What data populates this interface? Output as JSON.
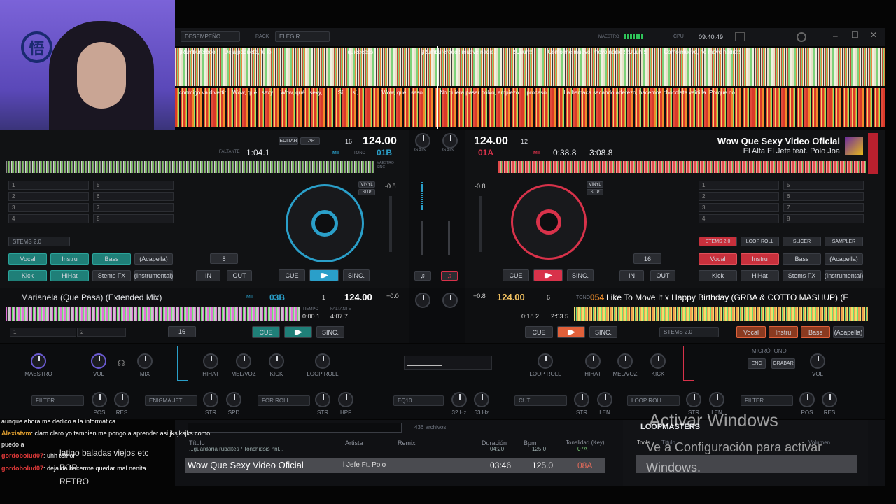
{
  "topbar": {
    "layout": "DESEMPEÑO",
    "rack_label": "RACK",
    "rack_value": "ELEGIR",
    "master_label": "MAESTRO",
    "cpu_label": "CPU",
    "clock": "09:40:49"
  },
  "lyrics": {
    "top": [
      "¡Rumbureroool!",
      "Deja paquete, tú lo",
      "quieeeess",
      "¡Rumbureroool! mueve nadie.",
      "!!Uuuh!!",
      "Como me muevo, movo nadie !!!Uuuh!!!",
      "Como muevo, no move nadie!!!"
    ],
    "bottom": [
      "conmigo va divertir",
      "Wow, qué",
      "sexy.",
      "Wow, qué",
      "sexy,",
      "Sí,",
      "sí,",
      "Wow, qué",
      "seso.",
      "No quiera pasar polvo, empiezo.",
      "proceso.",
      "La hamaca sacando aderezo, hacemos chocolate vainilla. Porque no"
    ]
  },
  "deckA": {
    "editar": "EDITAR",
    "tap": "TAP",
    "num": "16",
    "bpm": "124.00",
    "mt": "MT",
    "tono": "TONO",
    "key": "01B",
    "remaining_label": "FALTANTE",
    "remaining": "1:04.1",
    "maestro_sinc": "MAESTRO SINC",
    "hot_slots": [
      "1",
      "2",
      "3",
      "4",
      "5",
      "6",
      "7",
      "8"
    ],
    "stems": "STEMS 2.0",
    "stem_buttons": [
      "Vocal",
      "Instru",
      "Bass",
      "(Acapella)",
      "Kick",
      "HiHat",
      "Stems FX",
      "(Instrumental)"
    ],
    "loop_value": "8",
    "in": "IN",
    "out": "OUT",
    "cue": "CUE",
    "sync": "SINC.",
    "pitch": "-0.8",
    "vinyl": "VINYL",
    "slip": "SLIP"
  },
  "deckB": {
    "bpm": "124.00",
    "num": "12",
    "key": "01A",
    "mt": "MT",
    "elapsed": "0:38.8",
    "total": "3:08.8",
    "title": "Wow Que Sexy  Video Oficial",
    "artist": "El Alfa El Jefe feat. Polo Joa",
    "hot_slots": [
      "1",
      "2",
      "3",
      "4",
      "5",
      "6",
      "7",
      "8"
    ],
    "pad_modes": [
      "STEMS 2.0",
      "LOOP ROLL",
      "SLICER",
      "SAMPLER"
    ],
    "stem_buttons": [
      "Vocal",
      "Instru",
      "Bass",
      "(Acapella)",
      "Kick",
      "HiHat",
      "Stems FX",
      "(Instrumental)"
    ],
    "loop_value": "16",
    "in": "IN",
    "out": "OUT",
    "cue": "CUE",
    "sync": "SINC.",
    "pitch": "-0.8",
    "vinyl": "VINYL",
    "slip": "SLIP"
  },
  "mixer": {
    "gain_a": "GAIN",
    "gain_b": "GAIN"
  },
  "deckC": {
    "title": "Marianela (Que Pasa) (Extended Mix)",
    "mt": "MT",
    "key": "03B",
    "num": "1",
    "bpm": "124.00",
    "time_label": "TIEMPO",
    "elapsed": "0:00.1",
    "remaining_label": "FALTANTE",
    "remaining": "4:07.7",
    "pitch": "+0.0",
    "slots": [
      "1",
      "2"
    ],
    "loop_value": "16",
    "cue": "CUE",
    "sync": "SINC."
  },
  "deckD": {
    "bpm": "124.00",
    "num": "6",
    "tono_label": "TONO",
    "key": "054",
    "title": "Like To Move It x Happy Birthday (GRBA & COTTO MASHUP) (F",
    "elapsed": "0:18.2",
    "remaining": "2:53.5",
    "pitch": "+0.8",
    "cue": "CUE",
    "sync": "SINC.",
    "stems": "STEMS 2.0",
    "stem_buttons": [
      "Vocal",
      "Instru",
      "Bass",
      "(Acapella)"
    ]
  },
  "fx": {
    "left_knobs": [
      "MAESTRO",
      "VOL",
      "MIX",
      "HIHAT",
      "MEL/VOZ",
      "KICK",
      "LOOP ROLL"
    ],
    "right_knobs": [
      "LOOP ROLL",
      "HIHAT",
      "MEL/VOZ",
      "KICK",
      "VOL"
    ],
    "mic_label": "MICRÓFONO",
    "mic_on": "ENC",
    "mic_rec": "GRABAR",
    "row2_left": [
      "FILTER",
      "ENIGMA JET",
      "FOR ROLL"
    ],
    "row2_left_knobs": [
      "POS",
      "RES",
      "STR",
      "SPD",
      "STR",
      "HPF"
    ],
    "row2_mid": "EQ10",
    "row2_mid_knobs": [
      "32 Hz",
      "63 Hz"
    ],
    "row2_right": [
      "CUT",
      "LOOP ROLL",
      "FILTER"
    ],
    "row2_right_knobs": [
      "STR",
      "LEN",
      "STR",
      "LEN",
      "POS",
      "RES"
    ]
  },
  "browser": {
    "count": "436 archivos",
    "columns": [
      "Título",
      "Artista",
      "Remix",
      "Duración",
      "Bpm",
      "Tonalidad (Key)"
    ],
    "folders": [
      "latino baladas viejos etc",
      "POP",
      "RETRO"
    ],
    "row_top": {
      "title": "...guardaría rubaltes / Tonchidsis hnl...",
      "duration": "04:20",
      "bpm": "125.0",
      "key": "07A"
    },
    "row": {
      "title": "Wow Que Sexy  Video Oficial",
      "artist": "l Jefe Ft. Polo",
      "duration": "03:46",
      "bpm": "125.0",
      "key": "08A"
    },
    "side_title": "LOOPMASTERS",
    "side_cols": [
      "Título",
      "Volumen"
    ],
    "side_item": "Tools"
  },
  "chat": [
    {
      "user": "",
      "text": "aunque ahora me dedico a la informática",
      "color": "#ffffff"
    },
    {
      "user": "Alexiatvm",
      "text": ": claro claro yo tambien me pongo a aprender asi jksjksjks como",
      "color": "#e3a130"
    },
    {
      "user": "",
      "text": "puedo a",
      "color": "#ffffff"
    },
    {
      "user": "gordobolud07",
      "text": ": uhh temon",
      "color": "#e53a3a"
    },
    {
      "user": "gordobolud07",
      "text": ": deja de hacerme quedar mal nenita",
      "color": "#e53a3a"
    }
  ],
  "watermark": {
    "title": "Activar Windows",
    "subtitle": "Ve a Configuración para activar Windows."
  },
  "colors": {
    "deckA_accent": "#2a9fc9",
    "deckB_accent": "#d8324a",
    "stem_teal": "#1f7f78",
    "stem_red": "#c8303c"
  }
}
